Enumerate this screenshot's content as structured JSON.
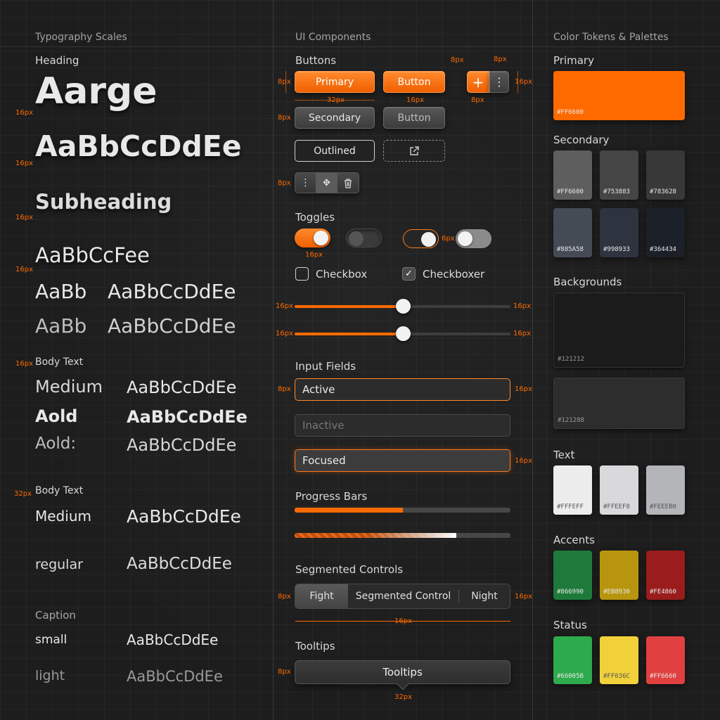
{
  "columns": {
    "typography": "Typography Scales",
    "components": "UI Components",
    "colors": "Color Tokens & Palettes"
  },
  "typography": {
    "heading_label": "Heading",
    "large": "Aarge",
    "h1": "AaBbCcDdEe",
    "subheading": "Subheading",
    "h3": "AaBbCcFee",
    "h4_short": "AaBb",
    "h4_long": "AaBbCcDdEe",
    "h5_short": "AaBb",
    "h5_long": "AaBbCcDdEe",
    "body_label_1": "Body Text",
    "body1": [
      {
        "name": "Medium",
        "sample": "AaBbCcDdEe"
      },
      {
        "name": "Aold",
        "sample": "AaBbCcDdEe"
      },
      {
        "name": "Aold:",
        "sample": "AaBbCcDdEe"
      }
    ],
    "body_label_2": "Body Text",
    "body2": [
      {
        "name": "Medium",
        "sample": "AaBbCcDdEe"
      },
      {
        "name": "regular",
        "sample": "AaBbCcDdEe"
      }
    ],
    "caption_label": "Caption",
    "caption": [
      {
        "name": "small",
        "sample": "AaBbCcDdEe"
      },
      {
        "name": "light",
        "sample": "AaBbCcDdEe"
      }
    ],
    "dims": [
      "16px",
      "16px",
      "16px",
      "16px",
      "16px",
      "32px"
    ]
  },
  "components": {
    "buttons_label": "Buttons",
    "primary": "Primary",
    "button": "Button",
    "secondary": "Secondary",
    "button2": "Button",
    "outlined": "Outlined",
    "toggles_label": "Toggles",
    "checkbox": "Checkbox",
    "checkboxer": "Checkboxer",
    "sliders": [
      0.5,
      0.5
    ],
    "inputs_label": "Input Fields",
    "active": "Active",
    "inactive": "Inactive",
    "focused": "Focused",
    "progress_label": "Progress Bars",
    "progress": [
      0.5,
      0.75
    ],
    "segmented_label": "Segmented Controls",
    "segments": [
      "Fight",
      "Segmented Control",
      "Night"
    ],
    "tooltips_label": "Tooltips",
    "tooltip": "Tooltips",
    "dims": {
      "d8": "8px",
      "d16": "16px",
      "d32": "32px",
      "d6": "6px"
    }
  },
  "colors": {
    "primary_label": "Primary",
    "primary": {
      "code": "#FF6600",
      "hex": "#ff6a00"
    },
    "secondary_label": "Secondary",
    "secondary": [
      {
        "code": "#FF6600",
        "hex": "#5e5e5e"
      },
      {
        "code": "#753883",
        "hex": "#454545"
      },
      {
        "code": "#783628",
        "hex": "#383838"
      },
      {
        "code": "#885A58",
        "hex": "#454b55"
      },
      {
        "code": "#998933",
        "hex": "#2e3340"
      },
      {
        "code": "#364434",
        "hex": "#1c2028"
      }
    ],
    "backgrounds_label": "Backgrounds",
    "backgrounds": [
      {
        "code": "#121212",
        "hex": "#1b1b1b"
      },
      {
        "code": "#121288",
        "hex": "#2d2d2d"
      }
    ],
    "text_label": "Text",
    "text": [
      {
        "code": "#FFFEFF",
        "hex": "#ececec"
      },
      {
        "code": "#FFEEF8",
        "hex": "#d9d9db"
      },
      {
        "code": "#FEEEB0",
        "hex": "#b4b5b8"
      }
    ],
    "accents_label": "Accents",
    "accents": [
      {
        "code": "#866990",
        "hex": "#1d7a3a"
      },
      {
        "code": "#EB8930",
        "hex": "#b8950e"
      },
      {
        "code": "#FE4860",
        "hex": "#9a1c1c"
      }
    ],
    "status_label": "Status",
    "status": [
      {
        "code": "#66005B",
        "hex": "#2daa4c"
      },
      {
        "code": "#FF036C",
        "hex": "#f1d13a"
      },
      {
        "code": "#FF6660",
        "hex": "#e14040"
      }
    ]
  }
}
